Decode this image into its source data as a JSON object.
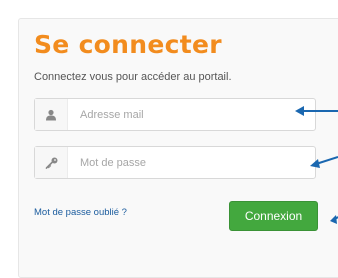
{
  "login": {
    "title": "Se connecter",
    "subtitle": "Connectez vous pour accéder au portail.",
    "email_placeholder": "Adresse mail",
    "password_placeholder": "Mot de passe",
    "forgot_password": "Mot de passe oublié ?",
    "submit_label": "Connexion"
  },
  "icons": {
    "email_field": "user-icon",
    "password_field": "key-icon",
    "annotations": "arrow-left-icon"
  },
  "colors": {
    "title": "#f28c1e",
    "button": "#43a83e",
    "link": "#1b5c9e",
    "arrow": "#1a67b0"
  }
}
